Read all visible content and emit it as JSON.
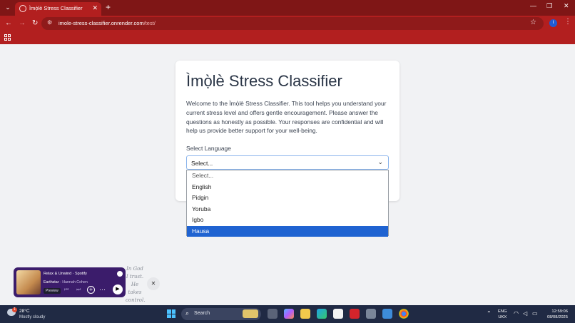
{
  "browser": {
    "tab_title": "Ìmọ̀lè Stress Classifier",
    "url_host": "imole-stress-classifier.onrender.com",
    "url_path": "/test/",
    "profile_initial": "I"
  },
  "card": {
    "title": "Ìmọ̀lè Stress Classifier",
    "description": "Welcome to the Ìmọ̀lè Stress Classifier. This tool helps you understand your current stress level and offers gentle encouragement. Please answer the questions as honestly as possible. Your responses are confidential and will help us provide better support for your well-being.",
    "select_label": "Select Language",
    "select_value": "Select..."
  },
  "dropdown": {
    "options": [
      "Select...",
      "English",
      "Pidgin",
      "Yoruba",
      "Igbo",
      "Hausa"
    ],
    "highlighted": "Hausa"
  },
  "spotify": {
    "title": "Relax & Unwind · Spotify",
    "track": "Earthstar",
    "artist": "Hannah Cohen",
    "preview_label": "Preview"
  },
  "quote": {
    "text": "In God I trust. He takes control."
  },
  "taskbar": {
    "temperature": "28°C",
    "weather": "Mostly cloudy",
    "weather_badge": "1",
    "search_placeholder": "Search",
    "lang_line1": "ENG",
    "lang_line2": "UKX",
    "time": "12:59:06",
    "date": "08/08/2025"
  },
  "colors": {
    "chrome_dark": "#7f1616",
    "chrome": "#b21f1f",
    "highlight": "#1f63d1",
    "spotify_bg": "#3b1c6b"
  }
}
